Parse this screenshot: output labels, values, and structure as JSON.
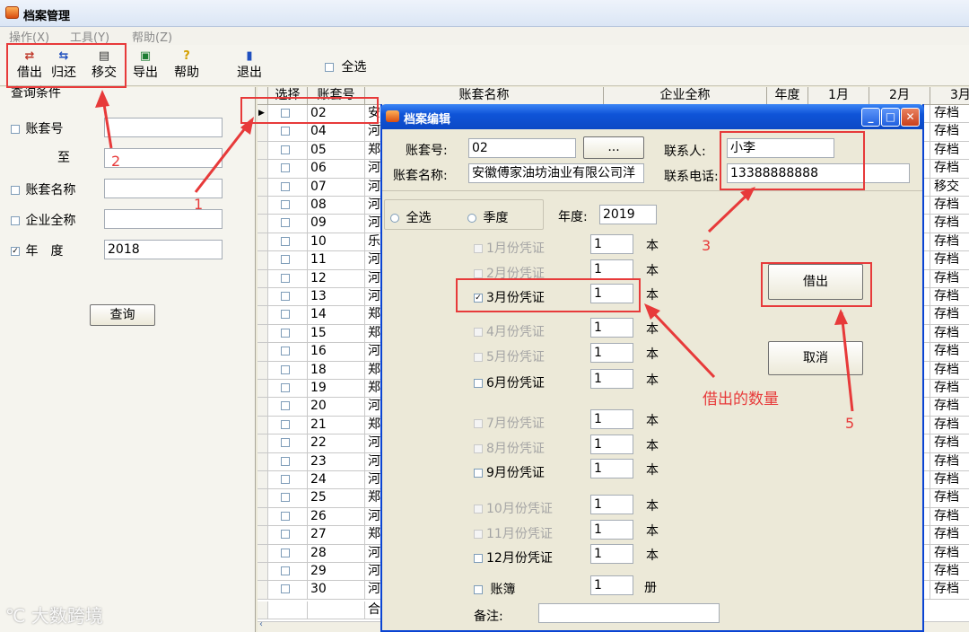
{
  "window": {
    "title": "档案管理"
  },
  "menu": [
    "操作(X)",
    "工具(Y)",
    "帮助(Z)"
  ],
  "toolbar": {
    "lend": "借出",
    "return": "归还",
    "transfer": "移交",
    "export": "导出",
    "help": "帮助",
    "exit": "退出",
    "select_all": "全选"
  },
  "query": {
    "title": "查询条件",
    "account_no": "账套号",
    "to": "至",
    "account_name": "账套名称",
    "company_name": "企业全称",
    "year_label": "年　度",
    "year_value": "2018",
    "button": "查询"
  },
  "grid": {
    "headers": [
      "选择",
      "账套号",
      "账套名称",
      "企业全称",
      "年度",
      "1月",
      "2月",
      "3月"
    ],
    "rows": [
      {
        "no": "02",
        "name": "安",
        "status": "存档"
      },
      {
        "no": "04",
        "name": "河",
        "status": "存档"
      },
      {
        "no": "05",
        "name": "郑",
        "status": "存档"
      },
      {
        "no": "06",
        "name": "河",
        "status": "存档"
      },
      {
        "no": "07",
        "name": "河",
        "status": "移交"
      },
      {
        "no": "08",
        "name": "河",
        "status": "存档"
      },
      {
        "no": "09",
        "name": "河",
        "status": "存档"
      },
      {
        "no": "10",
        "name": "乐",
        "status": "存档"
      },
      {
        "no": "11",
        "name": "河",
        "status": "存档"
      },
      {
        "no": "12",
        "name": "河",
        "status": "存档"
      },
      {
        "no": "13",
        "name": "河",
        "status": "存档"
      },
      {
        "no": "14",
        "name": "郑",
        "status": "存档"
      },
      {
        "no": "15",
        "name": "郑",
        "status": "存档"
      },
      {
        "no": "16",
        "name": "河",
        "status": "存档"
      },
      {
        "no": "18",
        "name": "郑",
        "status": "存档"
      },
      {
        "no": "19",
        "name": "郑",
        "status": "存档"
      },
      {
        "no": "20",
        "name": "河",
        "status": "存档"
      },
      {
        "no": "21",
        "name": "郑",
        "status": "存档"
      },
      {
        "no": "22",
        "name": "河",
        "status": "存档"
      },
      {
        "no": "23",
        "name": "河",
        "status": "存档"
      },
      {
        "no": "24",
        "name": "河",
        "status": "存档"
      },
      {
        "no": "25",
        "name": "郑",
        "status": "存档"
      },
      {
        "no": "26",
        "name": "河",
        "status": "存档"
      },
      {
        "no": "27",
        "name": "郑",
        "status": "存档"
      },
      {
        "no": "28",
        "name": "河",
        "status": "存档"
      },
      {
        "no": "29",
        "name": "河",
        "status": "存档"
      },
      {
        "no": "30",
        "name": "河",
        "status": "存档"
      }
    ],
    "total_label": "合"
  },
  "dialog": {
    "title": "档案编辑",
    "account_no_label": "账套号:",
    "account_no": "02",
    "browse": "...",
    "contact_label": "联系人:",
    "contact": "小李",
    "account_name_label": "账套名称:",
    "account_name": "安徽傅家油坊油业有限公司洋",
    "phone_label": "联系电话:",
    "phone": "13388888888",
    "radio_all": "全选",
    "radio_quarter": "季度",
    "year_label": "年度:",
    "year": "2019",
    "unit_ben": "本",
    "unit_ce": "册",
    "months": [
      {
        "label": "1月份凭证",
        "qty": "1",
        "checked": false,
        "enabled": false
      },
      {
        "label": "2月份凭证",
        "qty": "1",
        "checked": false,
        "enabled": false
      },
      {
        "label": "3月份凭证",
        "qty": "1",
        "checked": true,
        "enabled": true
      },
      {
        "label": "4月份凭证",
        "qty": "1",
        "checked": false,
        "enabled": false
      },
      {
        "label": "5月份凭证",
        "qty": "1",
        "checked": false,
        "enabled": false
      },
      {
        "label": "6月份凭证",
        "qty": "1",
        "checked": false,
        "enabled": true
      },
      {
        "label": "7月份凭证",
        "qty": "1",
        "checked": false,
        "enabled": false
      },
      {
        "label": "8月份凭证",
        "qty": "1",
        "checked": false,
        "enabled": false
      },
      {
        "label": "9月份凭证",
        "qty": "1",
        "checked": false,
        "enabled": true
      },
      {
        "label": "10月份凭证",
        "qty": "1",
        "checked": false,
        "enabled": false
      },
      {
        "label": "11月份凭证",
        "qty": "1",
        "checked": false,
        "enabled": false
      },
      {
        "label": "12月份凭证",
        "qty": "1",
        "checked": false,
        "enabled": true
      }
    ],
    "ledger": {
      "label": "账簿",
      "qty": "1"
    },
    "remark_label": "备注:",
    "lend_button": "借出",
    "cancel_button": "取消"
  },
  "annotations": {
    "n1": "1",
    "n2": "2",
    "n3": "3",
    "n5": "5",
    "qty_note": "借出的数量"
  },
  "watermark": "大数跨境"
}
